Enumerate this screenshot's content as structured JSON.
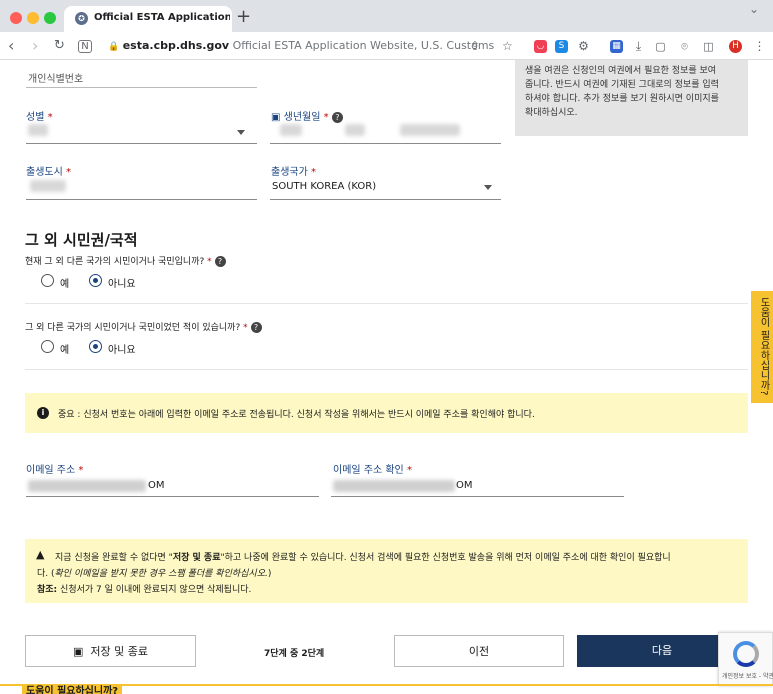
{
  "browser": {
    "tab_title": "Official ESTA Application Website",
    "url_host": "esta.cbp.dhs.gov",
    "url_page_title": "Official ESTA Application Website, U.S. Customs"
  },
  "form": {
    "national_id_label": "개인식별번호",
    "sex_label": "성별",
    "required_mark": "*",
    "birthdate_label": "생년월일",
    "birth_city_label": "출생도시",
    "birth_country_label": "출생국가",
    "birth_country_value": "SOUTH KOREA (KOR)",
    "side_note_lines": [
      "생을 여권은 신청인의 여권에서 필요한 정보를 보여",
      "줍니다. 반드시 여권에 기재된 그대로의 정보를 입력",
      "하셔야 합니다. 추가 정보를 보기 원하시면 이미지를",
      "확대하십시오."
    ],
    "section_title": "그 외 시민권/국적",
    "q1": "현재 그 외 다른 국가의 시민이거나 국민입니까?",
    "q2": "그 외 다른 국가의 시민이거나 국민이었던 적이 있습니까?",
    "yes": "예",
    "no": "아니요",
    "notice": "중요 : 신청서 번호는 아래에 입력한 이메일 주소로 전송됩니다. 신청서 작성을 위해서는 반드시 이메일 주소를 확인해야 합니다.",
    "email_label": "이메일 주소",
    "email_value_tail": "OM",
    "email_confirm_label": "이메일 주소 확인",
    "email_confirm_value_tail": "OM",
    "warn_line1_a": "지금 신청을 완료할 수 없다면 \"",
    "warn_line1_b": "저장 및 종료",
    "warn_line1_c": "\"하고 나중에 완료할 수 있습니다. 신청서 검색에 필요한 신청번호 발송을 위해 먼저 이메일 주소에 대한 확인이 필요합니",
    "warn_line2_a": "다. (",
    "warn_line2_b": "확인 이메일을 받지 못한 경우 스팸 폴더를 확인하십시오.",
    "warn_line2_c": ")",
    "warn_line3_a": "참조:",
    "warn_line3_b": " 신청서가 7 일 이내에 완료되지 않으면 삭제됩니다."
  },
  "footer": {
    "save_exit": "저장 및 종료",
    "step": "7단계 중 2단계",
    "previous": "이전",
    "next": "다음"
  },
  "help_tab": "도움이 필요하십니까?",
  "bottom_help": "도움이 필요하십니까?",
  "recaptcha_text": "개인정보 보호 - 약관",
  "colors": {
    "accent_blue": "#1a4480",
    "next_button": "#1b365d",
    "alert_bg": "#fdf8c4",
    "help_tab": "#f6c230",
    "required": "#b50909"
  }
}
